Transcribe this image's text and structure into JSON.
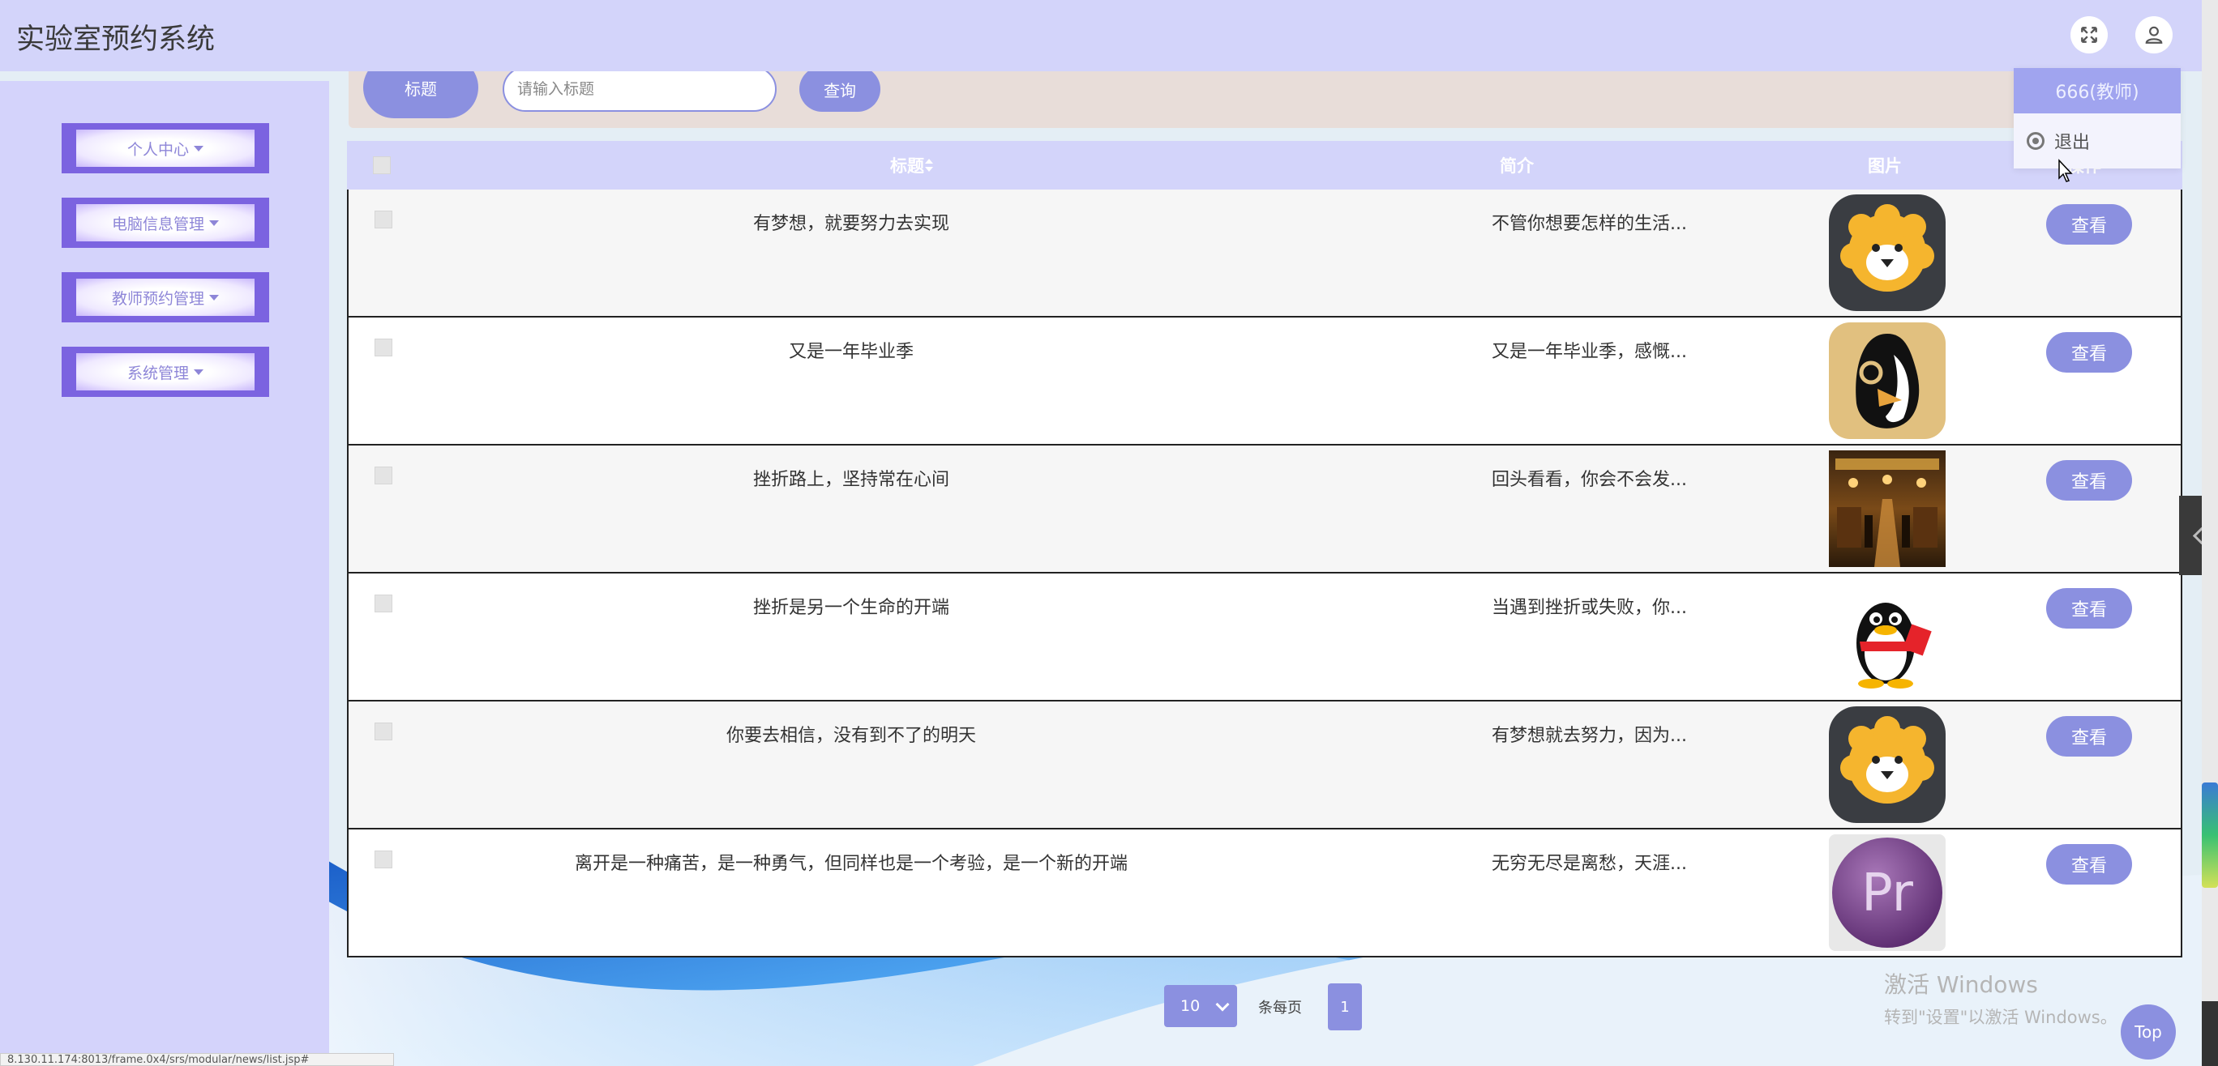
{
  "app": {
    "title": "实验室预约系统"
  },
  "header": {
    "fullscreen_icon": "fullscreen-icon",
    "user_icon": "user-icon"
  },
  "user_menu": {
    "username": "666(教师)",
    "logout_label": "退出"
  },
  "sidebar": {
    "items": [
      {
        "label": "个人中心"
      },
      {
        "label": "电脑信息管理"
      },
      {
        "label": "教师预约管理"
      },
      {
        "label": "系统管理"
      }
    ]
  },
  "search": {
    "field_label": "标题",
    "placeholder": "请输入标题",
    "button_label": "查询"
  },
  "table": {
    "columns": {
      "title": "标题",
      "desc": "简介",
      "image": "图片",
      "action": "操作"
    },
    "rows": [
      {
        "title": "有梦想，就要努力去实现",
        "desc": "不管你想要怎样的生活...",
        "image": "lion-app-icon",
        "action": "查看"
      },
      {
        "title": "又是一年毕业季",
        "desc": "又是一年毕业季，感慨...",
        "image": "penguin-app-icon",
        "action": "查看"
      },
      {
        "title": "挫折路上，坚持常在心间",
        "desc": "回头看看，你会不会发...",
        "image": "restaurant-photo",
        "action": "查看"
      },
      {
        "title": "挫折是另一个生命的开端",
        "desc": "当遇到挫折或失败，你...",
        "image": "qq-penguin-icon",
        "action": "查看"
      },
      {
        "title": "你要去相信，没有到不了的明天",
        "desc": "有梦想就去努力，因为...",
        "image": "lion-app-icon",
        "action": "查看"
      },
      {
        "title": "离开是一种痛苦，是一种勇气，但同样也是一个考验，是一个新的开端",
        "desc": "无穷无尽是离愁，天涯...",
        "image": "premiere-app-icon",
        "action": "查看"
      }
    ]
  },
  "pagination": {
    "page_size": "10",
    "per_page_label": "条每页",
    "current_page": "1"
  },
  "top_button": "Top",
  "watermark": {
    "line1": "激活 Windows",
    "line2": "转到\"设置\"以激活 Windows。"
  },
  "status_url": "8.130.11.174:8013/frame.0x4/srs/modular/news/list.jsp#",
  "colors": {
    "header_bg": "#d3d4fa",
    "accent": "#8b90e0",
    "sidebar_item": "#7b63e0"
  }
}
